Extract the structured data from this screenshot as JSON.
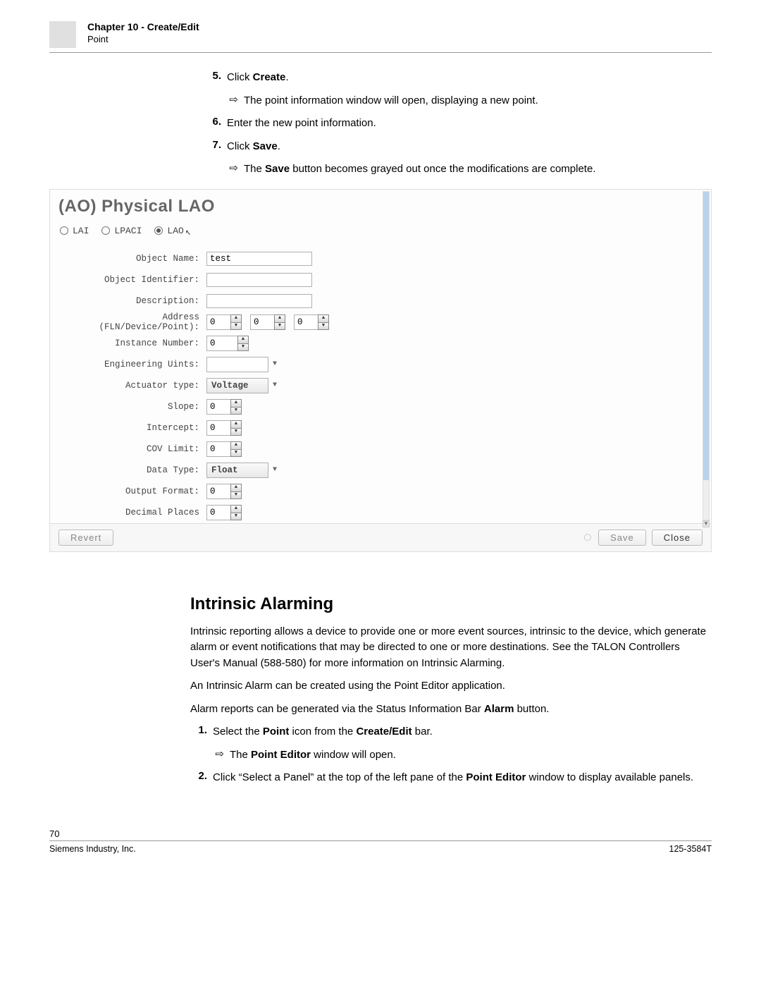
{
  "header": {
    "chapter": "Chapter 10 - Create/Edit",
    "sub": "Point"
  },
  "steps_top": {
    "s5_num": "5.",
    "s5_a": "Click ",
    "s5_b": "Create",
    "s5_c": ".",
    "s5_sub": "The point information window will open, displaying a new point.",
    "s6_num": "6.",
    "s6": "Enter the new point information.",
    "s7_num": "7.",
    "s7_a": "Click ",
    "s7_b": "Save",
    "s7_c": ".",
    "s7_sub_a": "The ",
    "s7_sub_b": "Save",
    "s7_sub_c": " button becomes grayed out once the modifications are complete."
  },
  "app": {
    "title": "(AO) Physical LAO",
    "radios": {
      "r1": "LAI",
      "r2": "LPACI",
      "r3": "LAO"
    },
    "labels": {
      "object_name": "Object Name:",
      "object_id": "Object Identifier:",
      "description": "Description:",
      "address": "Address (FLN/Device/Point):",
      "instance": "Instance Number:",
      "units": "Engineering Uints:",
      "actuator": "Actuator type:",
      "slope": "Slope:",
      "intercept": "Intercept:",
      "cov": "COV Limit:",
      "datatype": "Data Type:",
      "outfmt": "Output Format:",
      "decimals": "Decimal Places"
    },
    "values": {
      "object_name": "test",
      "object_id": "",
      "description": "",
      "addr_fln": "0",
      "addr_dev": "0",
      "addr_pt": "0",
      "instance": "0",
      "units": "",
      "actuator": "Voltage",
      "slope": "0",
      "intercept": "0",
      "cov": "0",
      "datatype": "Float",
      "outfmt": "0",
      "decimals": "0"
    },
    "buttons": {
      "revert": "Revert",
      "save": "Save",
      "close": "Close"
    }
  },
  "section": {
    "title": "Intrinsic Alarming",
    "p1": "Intrinsic reporting allows a device to provide one or more event sources, intrinsic to the device, which generate alarm or event notifications that may be directed to one or more destinations. See the TALON Controllers User's Manual (588-580) for more information on Intrinsic Alarming.",
    "p2": "An Intrinsic Alarm can be created using the Point Editor application.",
    "p3_a": "Alarm reports can be generated via the Status Information Bar ",
    "p3_b": "Alarm",
    "p3_c": " button.",
    "s1_num": "1.",
    "s1_a": "Select the ",
    "s1_b": "Point",
    "s1_c": " icon from the ",
    "s1_d": "Create/Edit",
    "s1_e": " bar.",
    "s1_sub_a": "The ",
    "s1_sub_b": "Point Editor",
    "s1_sub_c": " window will open.",
    "s2_num": "2.",
    "s2_a": "Click “Select a Panel” at the top of the left pane of the ",
    "s2_b": "Point Editor",
    "s2_c": " window to display available panels."
  },
  "footer": {
    "page": "70",
    "left": "Siemens Industry, Inc.",
    "right": "125-3584T"
  },
  "glyphs": {
    "arrow": "⇨",
    "up": "▲",
    "dn": "▼",
    "caret": "▼",
    "cursor": "↖"
  }
}
